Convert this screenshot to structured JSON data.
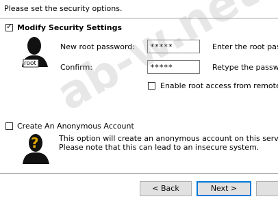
{
  "header": {
    "instruction": "Please set the security options."
  },
  "modify_security": {
    "label": "Modify Security Settings",
    "checked": true,
    "root_badge": "root",
    "new_password_label": "New root password:",
    "new_password_value": "*****",
    "new_password_hint": "Enter the root pass",
    "confirm_label": "Confirm:",
    "confirm_value": "*****",
    "confirm_hint": "Retype the passwo",
    "remote_root_label": "Enable root access from remote m",
    "remote_root_checked": false
  },
  "anonymous": {
    "label": "Create An Anonymous Account",
    "checked": false,
    "avatar_mark": "?",
    "description_line1": "This option will create an anonymous account on this server.",
    "description_line2": "Please note that this can lead to an insecure system."
  },
  "footer": {
    "back_label": "< Back",
    "next_label": "Next >"
  },
  "watermark": "ab-w.net",
  "colors": {
    "divider": "#a0a0a0",
    "button_face": "#e1e1e1",
    "focus_border": "#0078d7"
  }
}
